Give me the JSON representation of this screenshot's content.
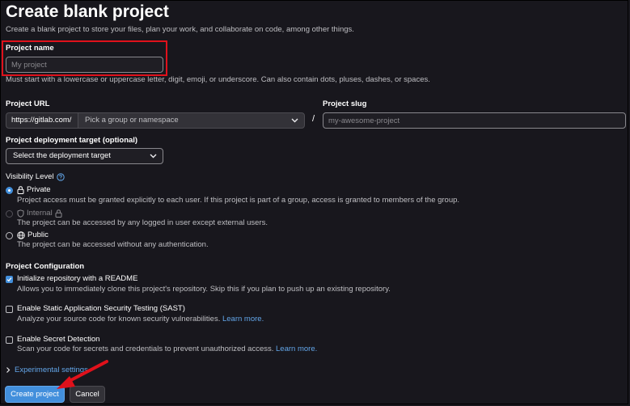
{
  "page": {
    "title": "Create blank project",
    "description": "Create a blank project to store your files, plan your work, and collaborate on code, among other things."
  },
  "project_name": {
    "label": "Project name",
    "placeholder": "My project",
    "help": "Must start with a lowercase or uppercase letter, digit, emoji, or underscore. Can also contain dots, pluses, dashes, or spaces."
  },
  "project_url": {
    "label": "Project URL",
    "prefix": "https://gitlab.com/",
    "namespace_placeholder": "Pick a group or namespace",
    "separator": "/"
  },
  "project_slug": {
    "label": "Project slug",
    "placeholder": "my-awesome-project"
  },
  "deployment": {
    "label": "Project deployment target (optional)",
    "selected": "Select the deployment target"
  },
  "visibility": {
    "label": "Visibility Level",
    "help_icon": "question-circle-icon",
    "options": [
      {
        "label": "Private",
        "icon": "lock-icon",
        "checked": true,
        "disabled": false,
        "description": "Project access must be granted explicitly to each user. If this project is part of a group, access is granted to members of the group."
      },
      {
        "label": "Internal",
        "icon": "shield-icon",
        "checked": false,
        "disabled": true,
        "description": "The project can be accessed by any logged in user except external users."
      },
      {
        "label": "Public",
        "icon": "globe-icon",
        "checked": false,
        "disabled": false,
        "description": "The project can be accessed without any authentication."
      }
    ]
  },
  "configuration": {
    "label": "Project Configuration",
    "readme": {
      "label": "Initialize repository with a README",
      "checked": true,
      "description": "Allows you to immediately clone this project's repository. Skip this if you plan to push up an existing repository."
    },
    "sast": {
      "label": "Enable Static Application Security Testing (SAST)",
      "checked": false,
      "description": "Analyze your source code for known security vulnerabilities.",
      "link": "Learn more."
    },
    "secret_detection": {
      "label": "Enable Secret Detection",
      "checked": false,
      "description": "Scan your code for secrets and credentials to prevent unauthorized access.",
      "link": "Learn more."
    }
  },
  "experimental": {
    "label": "Experimental settings"
  },
  "actions": {
    "create": "Create project",
    "cancel": "Cancel"
  },
  "colors": {
    "background": "#18171d",
    "accent": "#428fdc",
    "highlight": "#e0111b",
    "link": "#63a6e9"
  }
}
